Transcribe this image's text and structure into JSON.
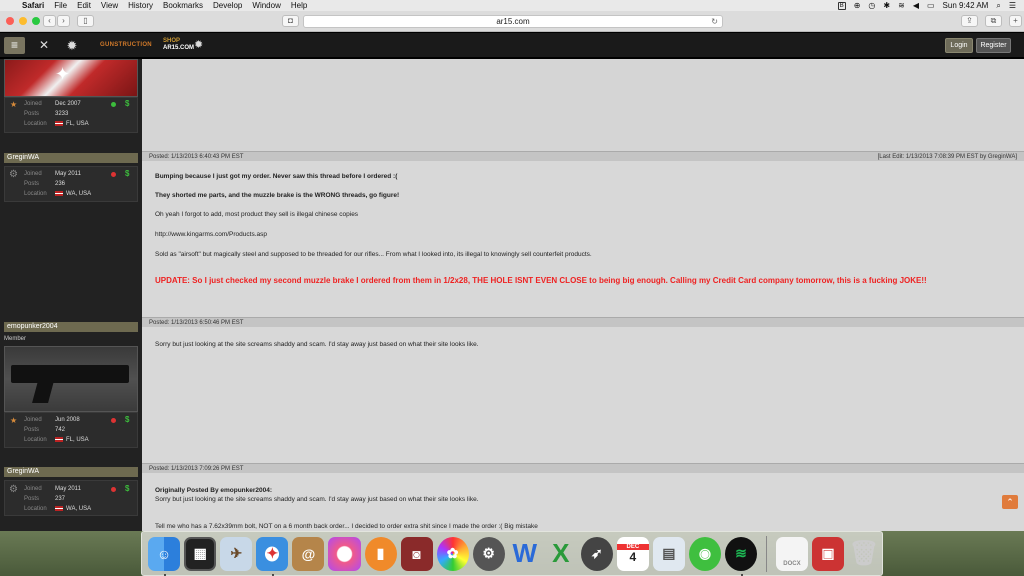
{
  "menubar": {
    "app": "Safari",
    "items": [
      "File",
      "Edit",
      "View",
      "History",
      "Bookmarks",
      "Develop",
      "Window",
      "Help"
    ],
    "clock": "Sun 9:42 AM",
    "battery": "100%"
  },
  "browser": {
    "url": "ar15.com"
  },
  "site": {
    "logo_left": "GUNSTRUCTION",
    "logo_right_top": "SHOP",
    "logo_right_bottom": "AR15.COM",
    "login": "Login",
    "register": "Register"
  },
  "users": [
    {
      "joined_label": "Joined",
      "joined": "Dec 2007",
      "posts_label": "Posts",
      "posts": "3233",
      "loc_label": "Location",
      "location": "FL, USA"
    },
    {
      "name": "GreginWA",
      "joined_label": "Joined",
      "joined": "May 2011",
      "posts_label": "Posts",
      "posts": "236",
      "loc_label": "Location",
      "location": "WA, USA"
    },
    {
      "name": "emopunker2004",
      "role": "Member",
      "joined_label": "Joined",
      "joined": "Jun 2008",
      "posts_label": "Posts",
      "posts": "742",
      "loc_label": "Location",
      "location": "FL, USA"
    },
    {
      "name": "GreginWA",
      "joined_label": "Joined",
      "joined": "May 2011",
      "posts_label": "Posts",
      "posts": "237",
      "loc_label": "Location",
      "location": "WA, USA"
    }
  ],
  "posts": [
    {
      "posted": "Posted: 1/13/2013 6:40:43 PM EST",
      "edit": "[Last Edit: 1/13/2013 7:08:39 PM EST by GreginWA]",
      "line1": "Bumping because I just got my order. Never saw this thread before I ordered :(",
      "line2": "They shorted me parts, and the muzzle brake is the WRONG threads, go figure!",
      "line3": "Oh yeah I forgot to add, most product they sell is illegal chinese copies",
      "line4": "http://www.kingarms.com/Products.asp",
      "line5": "Sold as \"airsoft\" but magically steel and supposed to be threaded for our rifles... From what I looked into, its illegal to knowingly sell counterfeit products.",
      "update": "UPDATE: So I just checked my second muzzle brake I ordered from them in 1/2x28, THE HOLE ISNT EVEN CLOSE to being big enough. Calling my Credit Card company tomorrow, this is a fucking JOKE!!"
    },
    {
      "posted": "Posted: 1/13/2013 6:50:46 PM EST",
      "line1": "Sorry but just looking at the site screams shaddy and scam. I'd stay away just based on what their site looks like."
    },
    {
      "posted": "Posted: 1/13/2013 7:09:26 PM EST",
      "quote_label": "Originally Posted By emopunker2004:",
      "quote": "Sorry but just looking at the site screams shaddy and scam. I'd stay away just based on what their site looks like.",
      "line1": "Tell me who has a 7.62x39mm bolt, NOT on a 6 month back order... I decided to order extra shit since I made the order :( Big mistake"
    }
  ],
  "dock": {
    "calendar_month": "DEC",
    "calendar_day": "4",
    "doc_label": "DOCX"
  }
}
